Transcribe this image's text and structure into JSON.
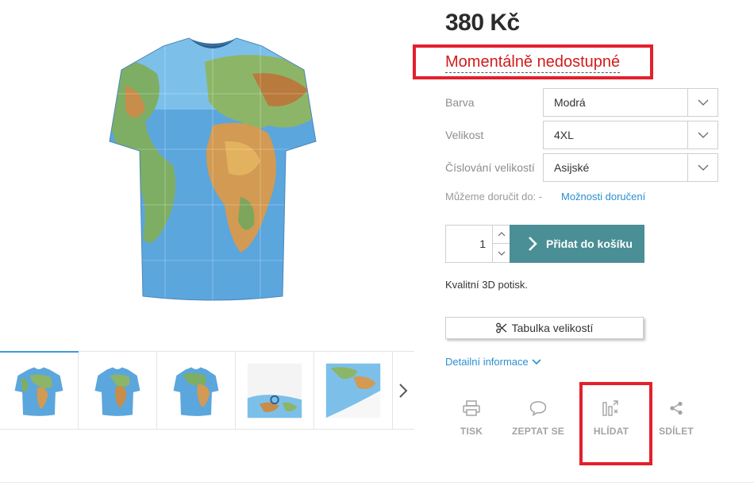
{
  "product": {
    "price": "380 Kč",
    "availability": "Momentálně nedostupné",
    "description": "Kvalitní 3D potisk."
  },
  "options": [
    {
      "label": "Barva",
      "value": "Modrá"
    },
    {
      "label": "Velikost",
      "value": "4XL"
    },
    {
      "label": "Číslování velikostí",
      "value": "Asijské"
    }
  ],
  "delivery": {
    "label": "Můžeme doručit do: -",
    "link": "Možnosti doručení"
  },
  "cart": {
    "quantity": "1",
    "add_label": "Přidat do košíku"
  },
  "size_table_label": "Tabulka velikostí",
  "detail_link": "Detailní informace",
  "actions": [
    {
      "label": "TISK",
      "icon": "printer-icon"
    },
    {
      "label": "ZEPTAT SE",
      "icon": "speech-bubble-icon"
    },
    {
      "label": "HLÍDAT",
      "icon": "watch-chart-icon"
    },
    {
      "label": "SDÍLET",
      "icon": "share-icon"
    }
  ],
  "colors": {
    "accent": "#4a8f96",
    "link": "#2b8fd0",
    "highlight": "#e3202c",
    "unavailable": "#d21b1b"
  }
}
